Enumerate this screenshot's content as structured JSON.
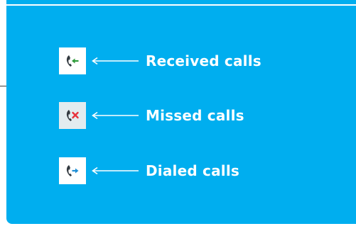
{
  "colors": {
    "panel_background": "#00aeef",
    "label_text": "#ffffff",
    "received_accent": "#2e9b3a",
    "missed_accent": "#e8323c",
    "dialed_accent": "#1f8fd6",
    "handset": "#333a40"
  },
  "legend": {
    "items": [
      {
        "label": "Received calls",
        "icon": "received-call-icon"
      },
      {
        "label": "Missed calls",
        "icon": "missed-call-icon"
      },
      {
        "label": "Dialed calls",
        "icon": "dialed-call-icon"
      }
    ]
  }
}
